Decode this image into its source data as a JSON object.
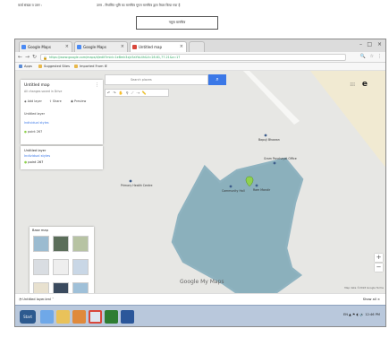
{
  "document": {
    "line_left": "कार्य संख्या व उत्तर :",
    "line_right": "उत्तर - निर्धारित भूमि का मानचित्र गूगल मानचित्र द्वारा तैयार किया गया है",
    "box_text": "नमूना मानचित्र"
  },
  "browser": {
    "tabs": [
      {
        "label": "Google Maps",
        "color": "#4a8af4"
      },
      {
        "label": "Google Maps",
        "color": "#4a8af4"
      },
      {
        "label": "Untitled map",
        "color": "#d9473b",
        "active": true
      }
    ],
    "url": "https://www.google.com/maps/d/edit?mid=1eBmk3xJc5aYbL4h&ll=28.61,77.21&z=17",
    "bookmarks": [
      "Apps",
      "Suggested Sites",
      "Imported From IE"
    ]
  },
  "map": {
    "panel": {
      "title": "Untitled map",
      "subtitle": "All changes saved in Drive",
      "actions": [
        "Add layer",
        "Share",
        "Preview"
      ],
      "layer_title": "Untitled layer",
      "layer_item": "Individual styles",
      "point_label": "point 267"
    },
    "base_map_title": "Base map",
    "search_placeholder": "Search places",
    "placemarks": [
      {
        "label": "Community Hall"
      },
      {
        "label": "Ram Mandir"
      },
      {
        "label": "Bapuji Bhawan"
      },
      {
        "label": "Gram Panchayat Office"
      },
      {
        "label": "Primary Health Centre"
      }
    ],
    "logo": "Google My Maps",
    "copyright": "Map data ©2018 Google  Terms",
    "account_initial": "e"
  },
  "downloads": {
    "item": "Untitled layer.kml",
    "show_all": "Show all"
  },
  "taskbar": {
    "start_label": "Start",
    "tray": "EN  ▲  ⚑  ◐  🔊  12:46 PM"
  },
  "colors": {
    "polygon_fill": "#7aa6b5",
    "polygon_stroke": "#8fb3c0",
    "search_btn": "#3b78e7",
    "map_bg": "#e7e7e4"
  }
}
